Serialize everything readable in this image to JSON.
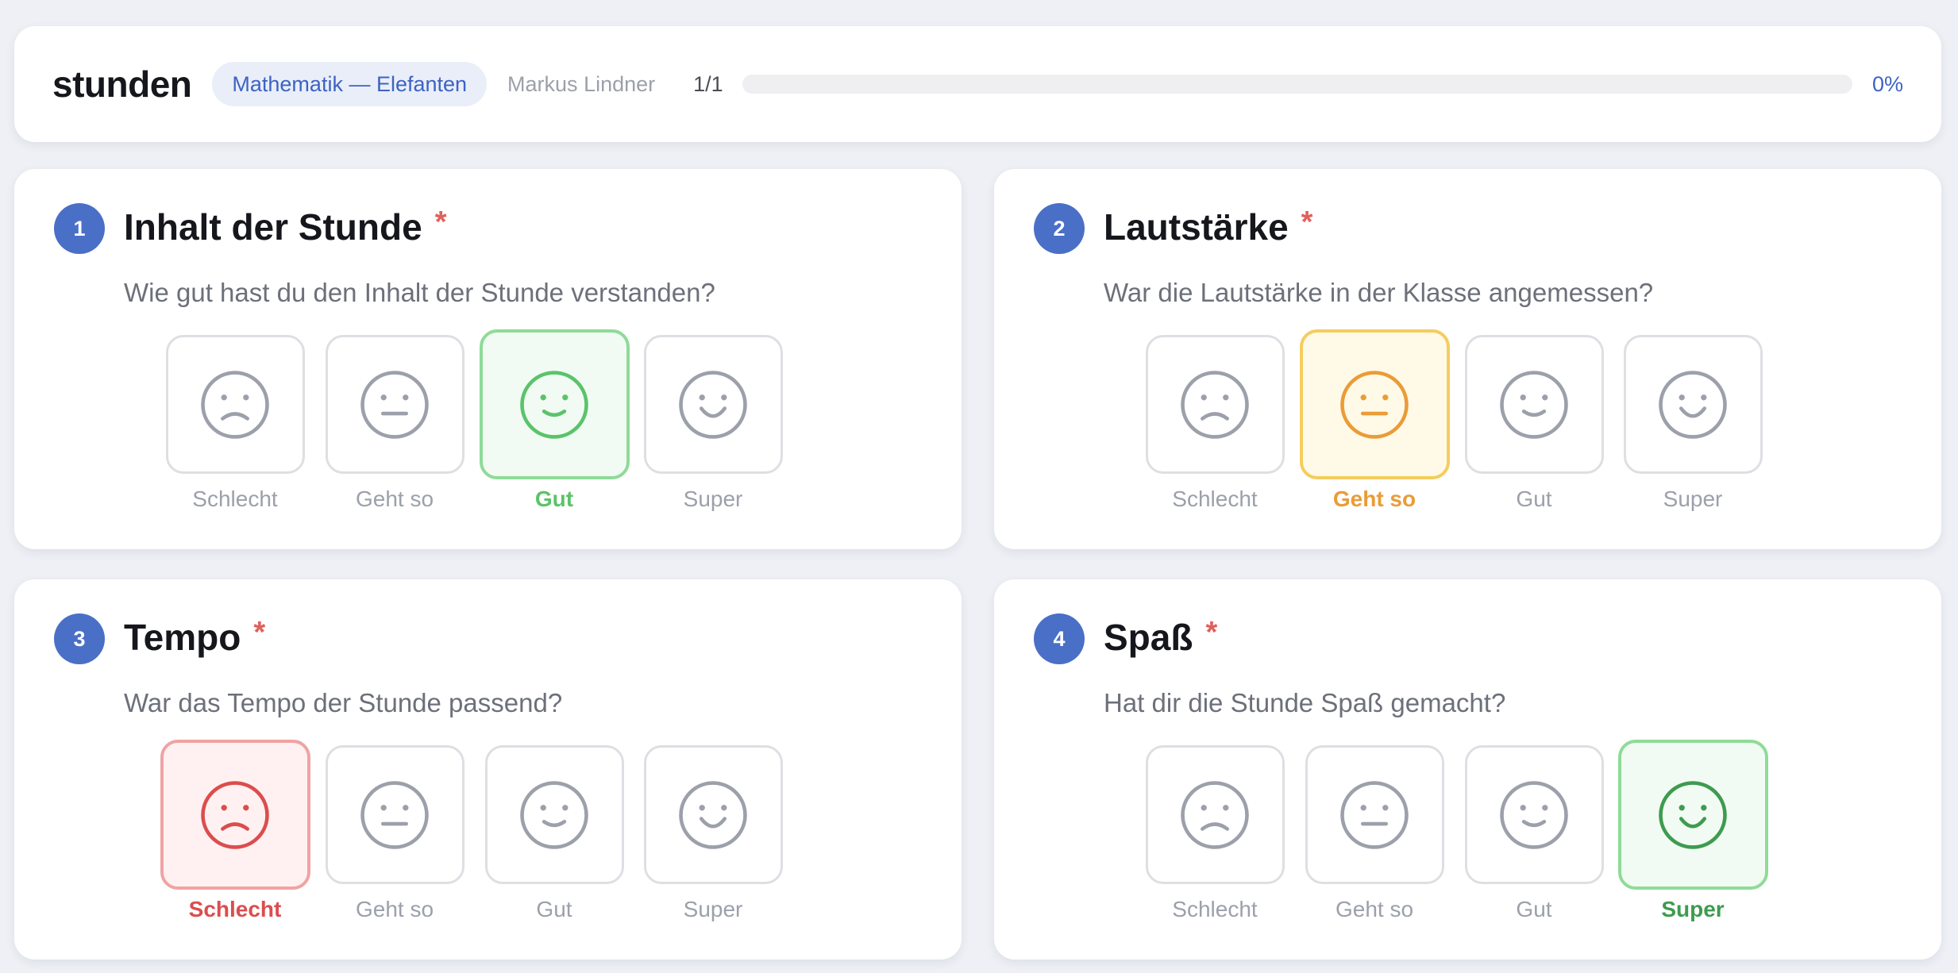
{
  "header": {
    "brand": "stunden",
    "class_name": "Mathematik — Elefanten",
    "teacher": "Markus Lindner",
    "page_count": "1/1",
    "progress_fraction": 0,
    "progress_label": "0%",
    "accent_color": "#4a6fc7"
  },
  "required_marker": "*",
  "option_labels": [
    "Schlecht",
    "Geht so",
    "Gut",
    "Super"
  ],
  "option_icons": [
    "sad-face-icon",
    "neutral-face-icon",
    "smile-face-icon",
    "happy-face-icon"
  ],
  "palette": {
    "neutral_border": "#dedfe3",
    "neutral_icon": "#9ca0aa",
    "selected_red": {
      "border": "#f0a3a3",
      "bg": "#fff1f1",
      "icon": "#dc4d4d"
    },
    "selected_yellow": {
      "border": "#f4cd5e",
      "bg": "#fffae8",
      "icon": "#ea9c38"
    },
    "selected_green": {
      "border": "#8fdb98",
      "bg": "#f1fbf3",
      "icon": "#5bc36a"
    },
    "selected_darkgreen": {
      "border": "#8fdb98",
      "bg": "#f1fbf3",
      "icon": "#3e9b4f"
    }
  },
  "questions": [
    {
      "number": "1",
      "title": "Inhalt der Stunde",
      "text": "Wie gut hast du den Inhalt der Stunde verstanden?",
      "selected": 2,
      "selected_style": "selected_green"
    },
    {
      "number": "2",
      "title": "Lautstärke",
      "text": "War die Lautstärke in der Klasse angemessen?",
      "selected": 1,
      "selected_style": "selected_yellow"
    },
    {
      "number": "3",
      "title": "Tempo",
      "text": "War das Tempo der Stunde passend?",
      "selected": 0,
      "selected_style": "selected_red"
    },
    {
      "number": "4",
      "title": "Spaß",
      "text": "Hat dir die Stunde Spaß gemacht?",
      "selected": 3,
      "selected_style": "selected_darkgreen"
    }
  ]
}
